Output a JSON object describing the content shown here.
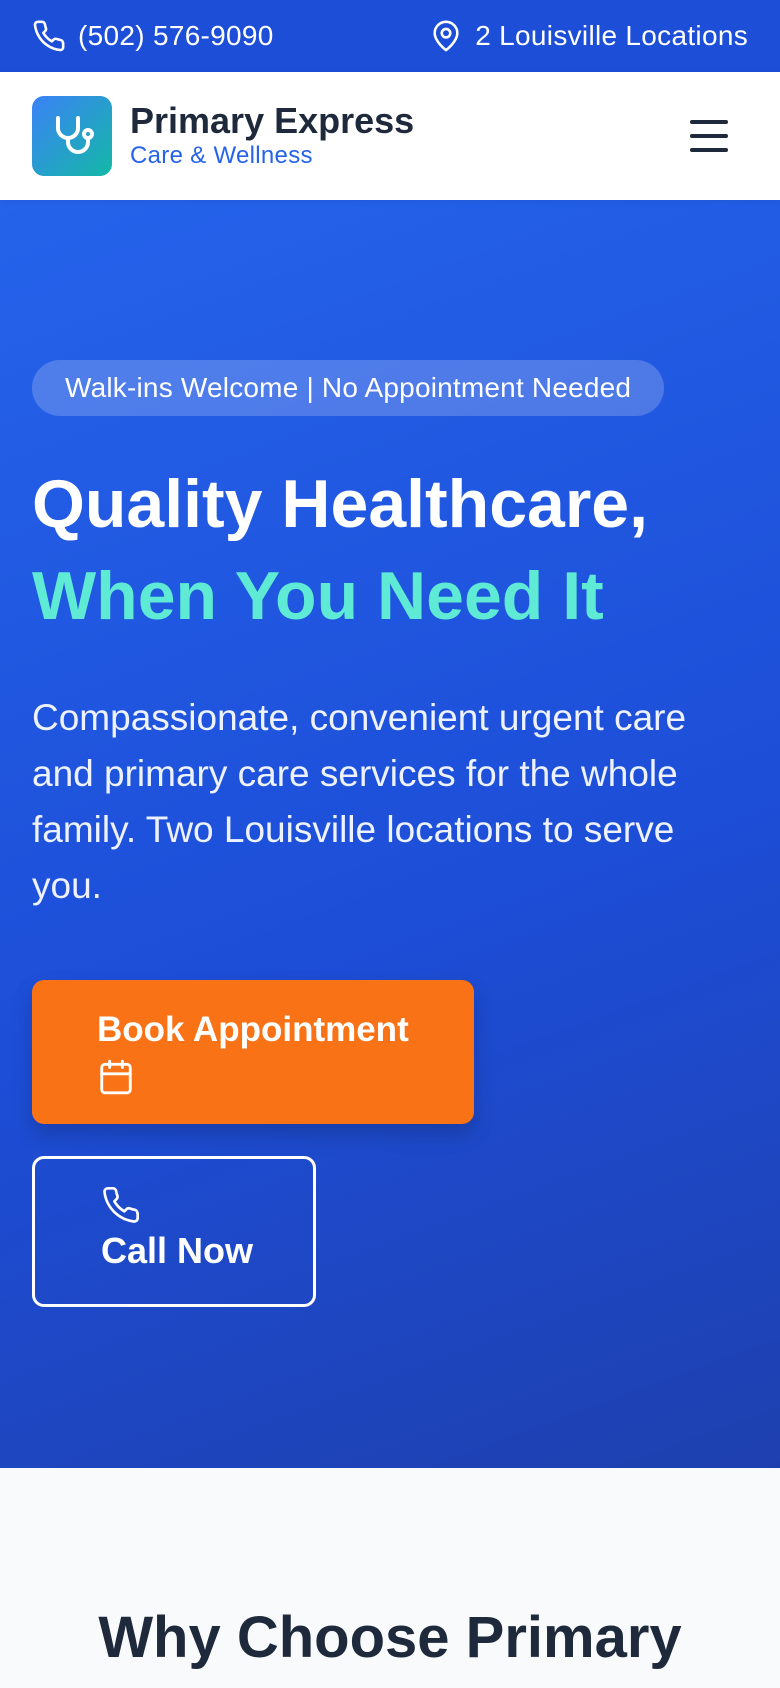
{
  "topbar": {
    "phone": "(502) 576-9090",
    "locations": "2 Louisville Locations",
    "bg_color": "#1d4ed8"
  },
  "header": {
    "brand_name": "Primary Express",
    "brand_sub": "Care & Wellness",
    "logo_icon": "stethoscope-icon",
    "menu_icon": "hamburger-menu-icon"
  },
  "hero": {
    "badge": "Walk-ins Welcome | No Appointment Needed",
    "title_line1": "Quality Healthcare,",
    "title_line2": "When You Need It",
    "lead": "Compassionate, convenient urgent care and primary care services for the whole family. Two Louisville locations to serve you.",
    "book_label": "Book Appointment",
    "book_icon": "calendar-icon",
    "call_label": "Call Now",
    "call_icon": "phone-icon",
    "accent_color": "#5eead4",
    "book_color": "#f97316"
  },
  "why": {
    "heading": "Why Choose Primary Express Care?"
  }
}
